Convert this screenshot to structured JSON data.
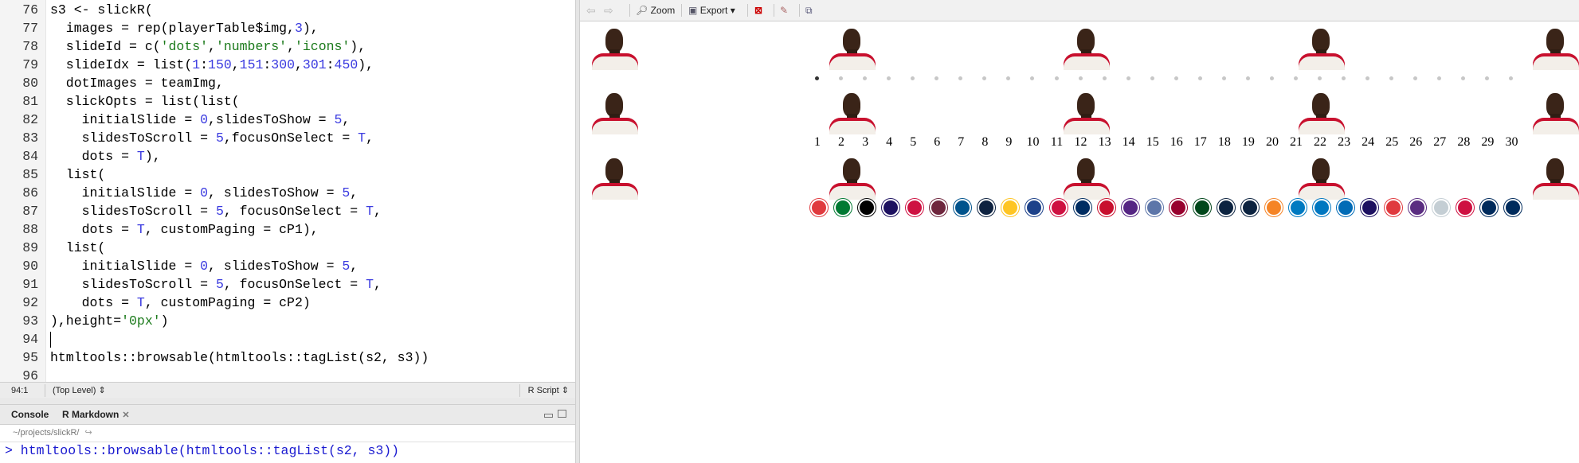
{
  "editor": {
    "lines": [
      {
        "n": "76",
        "code": [
          [
            "s3 <- slickR(",
            ""
          ]
        ]
      },
      {
        "n": "77",
        "code": [
          [
            "  images = rep(playerTable$img,",
            ""
          ],
          [
            "3",
            "num"
          ],
          [
            "),",
            ""
          ]
        ]
      },
      {
        "n": "78",
        "code": [
          [
            "  slideId = c(",
            ""
          ],
          [
            "'dots'",
            "str"
          ],
          [
            ",",
            ""
          ],
          [
            "'numbers'",
            "str"
          ],
          [
            ",",
            ""
          ],
          [
            "'icons'",
            "str"
          ],
          [
            "),",
            ""
          ]
        ]
      },
      {
        "n": "79",
        "code": [
          [
            "  slideIdx = list(",
            ""
          ],
          [
            "1",
            "num"
          ],
          [
            ":",
            ""
          ],
          [
            "150",
            "num"
          ],
          [
            ",",
            ""
          ],
          [
            "151",
            "num"
          ],
          [
            ":",
            ""
          ],
          [
            "300",
            "num"
          ],
          [
            ",",
            ""
          ],
          [
            "301",
            "num"
          ],
          [
            ":",
            ""
          ],
          [
            "450",
            "num"
          ],
          [
            "),",
            ""
          ]
        ]
      },
      {
        "n": "80",
        "code": [
          [
            "  dotImages = teamImg,",
            ""
          ]
        ]
      },
      {
        "n": "81",
        "code": [
          [
            "  slickOpts = list(list(",
            ""
          ]
        ]
      },
      {
        "n": "82",
        "code": [
          [
            "    initialSlide = ",
            ""
          ],
          [
            "0",
            "num"
          ],
          [
            ",slidesToShow = ",
            ""
          ],
          [
            "5",
            "num"
          ],
          [
            ",",
            ""
          ]
        ]
      },
      {
        "n": "83",
        "code": [
          [
            "    slidesToScroll = ",
            ""
          ],
          [
            "5",
            "num"
          ],
          [
            ",focusOnSelect = ",
            ""
          ],
          [
            "T",
            "kw"
          ],
          [
            ",",
            ""
          ]
        ]
      },
      {
        "n": "84",
        "code": [
          [
            "    dots = ",
            ""
          ],
          [
            "T",
            "kw"
          ],
          [
            "),",
            ""
          ]
        ]
      },
      {
        "n": "85",
        "code": [
          [
            "  list(",
            ""
          ]
        ]
      },
      {
        "n": "86",
        "code": [
          [
            "    initialSlide = ",
            ""
          ],
          [
            "0",
            "num"
          ],
          [
            ", slidesToShow = ",
            ""
          ],
          [
            "5",
            "num"
          ],
          [
            ",",
            ""
          ]
        ]
      },
      {
        "n": "87",
        "code": [
          [
            "    slidesToScroll = ",
            ""
          ],
          [
            "5",
            "num"
          ],
          [
            ", focusOnSelect = ",
            ""
          ],
          [
            "T",
            "kw"
          ],
          [
            ",",
            ""
          ]
        ]
      },
      {
        "n": "88",
        "code": [
          [
            "    dots = ",
            ""
          ],
          [
            "T",
            "kw"
          ],
          [
            ", customPaging = cP1),",
            ""
          ]
        ]
      },
      {
        "n": "89",
        "code": [
          [
            "  list(",
            ""
          ]
        ]
      },
      {
        "n": "90",
        "code": [
          [
            "    initialSlide = ",
            ""
          ],
          [
            "0",
            "num"
          ],
          [
            ", slidesToShow = ",
            ""
          ],
          [
            "5",
            "num"
          ],
          [
            ",",
            ""
          ]
        ]
      },
      {
        "n": "91",
        "code": [
          [
            "    slidesToScroll = ",
            ""
          ],
          [
            "5",
            "num"
          ],
          [
            ", focusOnSelect = ",
            ""
          ],
          [
            "T",
            "kw"
          ],
          [
            ",",
            ""
          ]
        ]
      },
      {
        "n": "92",
        "code": [
          [
            "    dots = ",
            ""
          ],
          [
            "T",
            "kw"
          ],
          [
            ", customPaging = cP2)",
            ""
          ]
        ]
      },
      {
        "n": "93",
        "code": [
          [
            "),height=",
            ""
          ],
          [
            "'0px'",
            "str"
          ],
          [
            ")",
            ""
          ]
        ]
      },
      {
        "n": "94",
        "code": [
          [
            "",
            ""
          ]
        ]
      },
      {
        "n": "95",
        "code": [
          [
            "htmltools::browsable(htmltools::tagList(s2, s3))",
            ""
          ]
        ]
      },
      {
        "n": "96",
        "code": [
          [
            "",
            ""
          ]
        ]
      }
    ],
    "status": {
      "position": "94:1",
      "scope": "(Top Level) ⇕",
      "filetype": "R Script ⇕"
    }
  },
  "console": {
    "tabs": [
      "Console",
      "R Markdown"
    ],
    "path": "~/projects/slickR/",
    "prompt": "> htmltools::browsable(htmltools::tagList(s2, s3))"
  },
  "viewer": {
    "toolbar": {
      "zoom": "Zoom",
      "export": "Export ▾"
    },
    "dots_count": 30,
    "active_dot": 1,
    "numbers": [
      "1",
      "2",
      "3",
      "4",
      "5",
      "6",
      "7",
      "8",
      "9",
      "10",
      "11",
      "12",
      "13",
      "14",
      "15",
      "16",
      "17",
      "18",
      "19",
      "20",
      "21",
      "22",
      "23",
      "24",
      "25",
      "26",
      "27",
      "28",
      "29",
      "30"
    ],
    "team_logo_colors": [
      "#e03a3e",
      "#007a33",
      "#000000",
      "#1d1160",
      "#ce1141",
      "#6f263d",
      "#00538c",
      "#0e2240",
      "#fec524",
      "#1d428a",
      "#ce1141",
      "#002d62",
      "#c8102e",
      "#552583",
      "#5d76a9",
      "#98002e",
      "#00471b",
      "#0c2340",
      "#0c2340",
      "#f58426",
      "#007ac1",
      "#0077c0",
      "#006bb6",
      "#1d1160",
      "#e03a3e",
      "#5a2d81",
      "#c4ced4",
      "#ce1141",
      "#002b5c",
      "#002b5c"
    ],
    "player_positions": 5
  }
}
